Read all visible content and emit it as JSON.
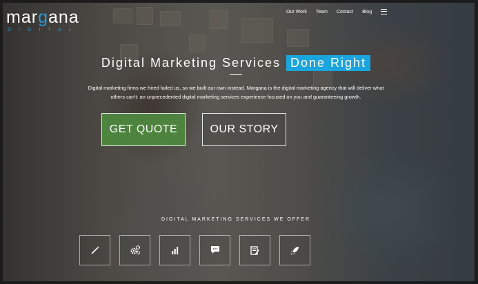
{
  "brand": {
    "word_before": "mar",
    "word_accent": "g",
    "word_after": "ana",
    "sub": "DIGITAL",
    "accent_color": "#2a9ad6"
  },
  "nav": {
    "items": [
      "Our Work",
      "Team",
      "Contact",
      "Blog"
    ],
    "menu_icon": "hamburger-icon"
  },
  "hero": {
    "headline": "Digital Marketing Services",
    "highlight": "Done Right",
    "highlight_color": "#1aa5de",
    "description_line1": "Digital marketing firms we hired failed us, so we built our own instead. Margana is the digital marketing agency that will deliver what",
    "description_line2": "others can't: an unprecedented digital marketing services experience focused on you and guaranteeing growth."
  },
  "buttons": {
    "quote": "GET QUOTE",
    "quote_color": "#4d8c3e",
    "story": "OUR STORY"
  },
  "services": {
    "heading": "DIGITAL MARKETING SERVICES WE OFFER",
    "icons": [
      "magic-wand-icon",
      "gears-icon",
      "bar-chart-icon",
      "chat-bubble-icon",
      "edit-document-icon",
      "rocket-icon"
    ]
  }
}
